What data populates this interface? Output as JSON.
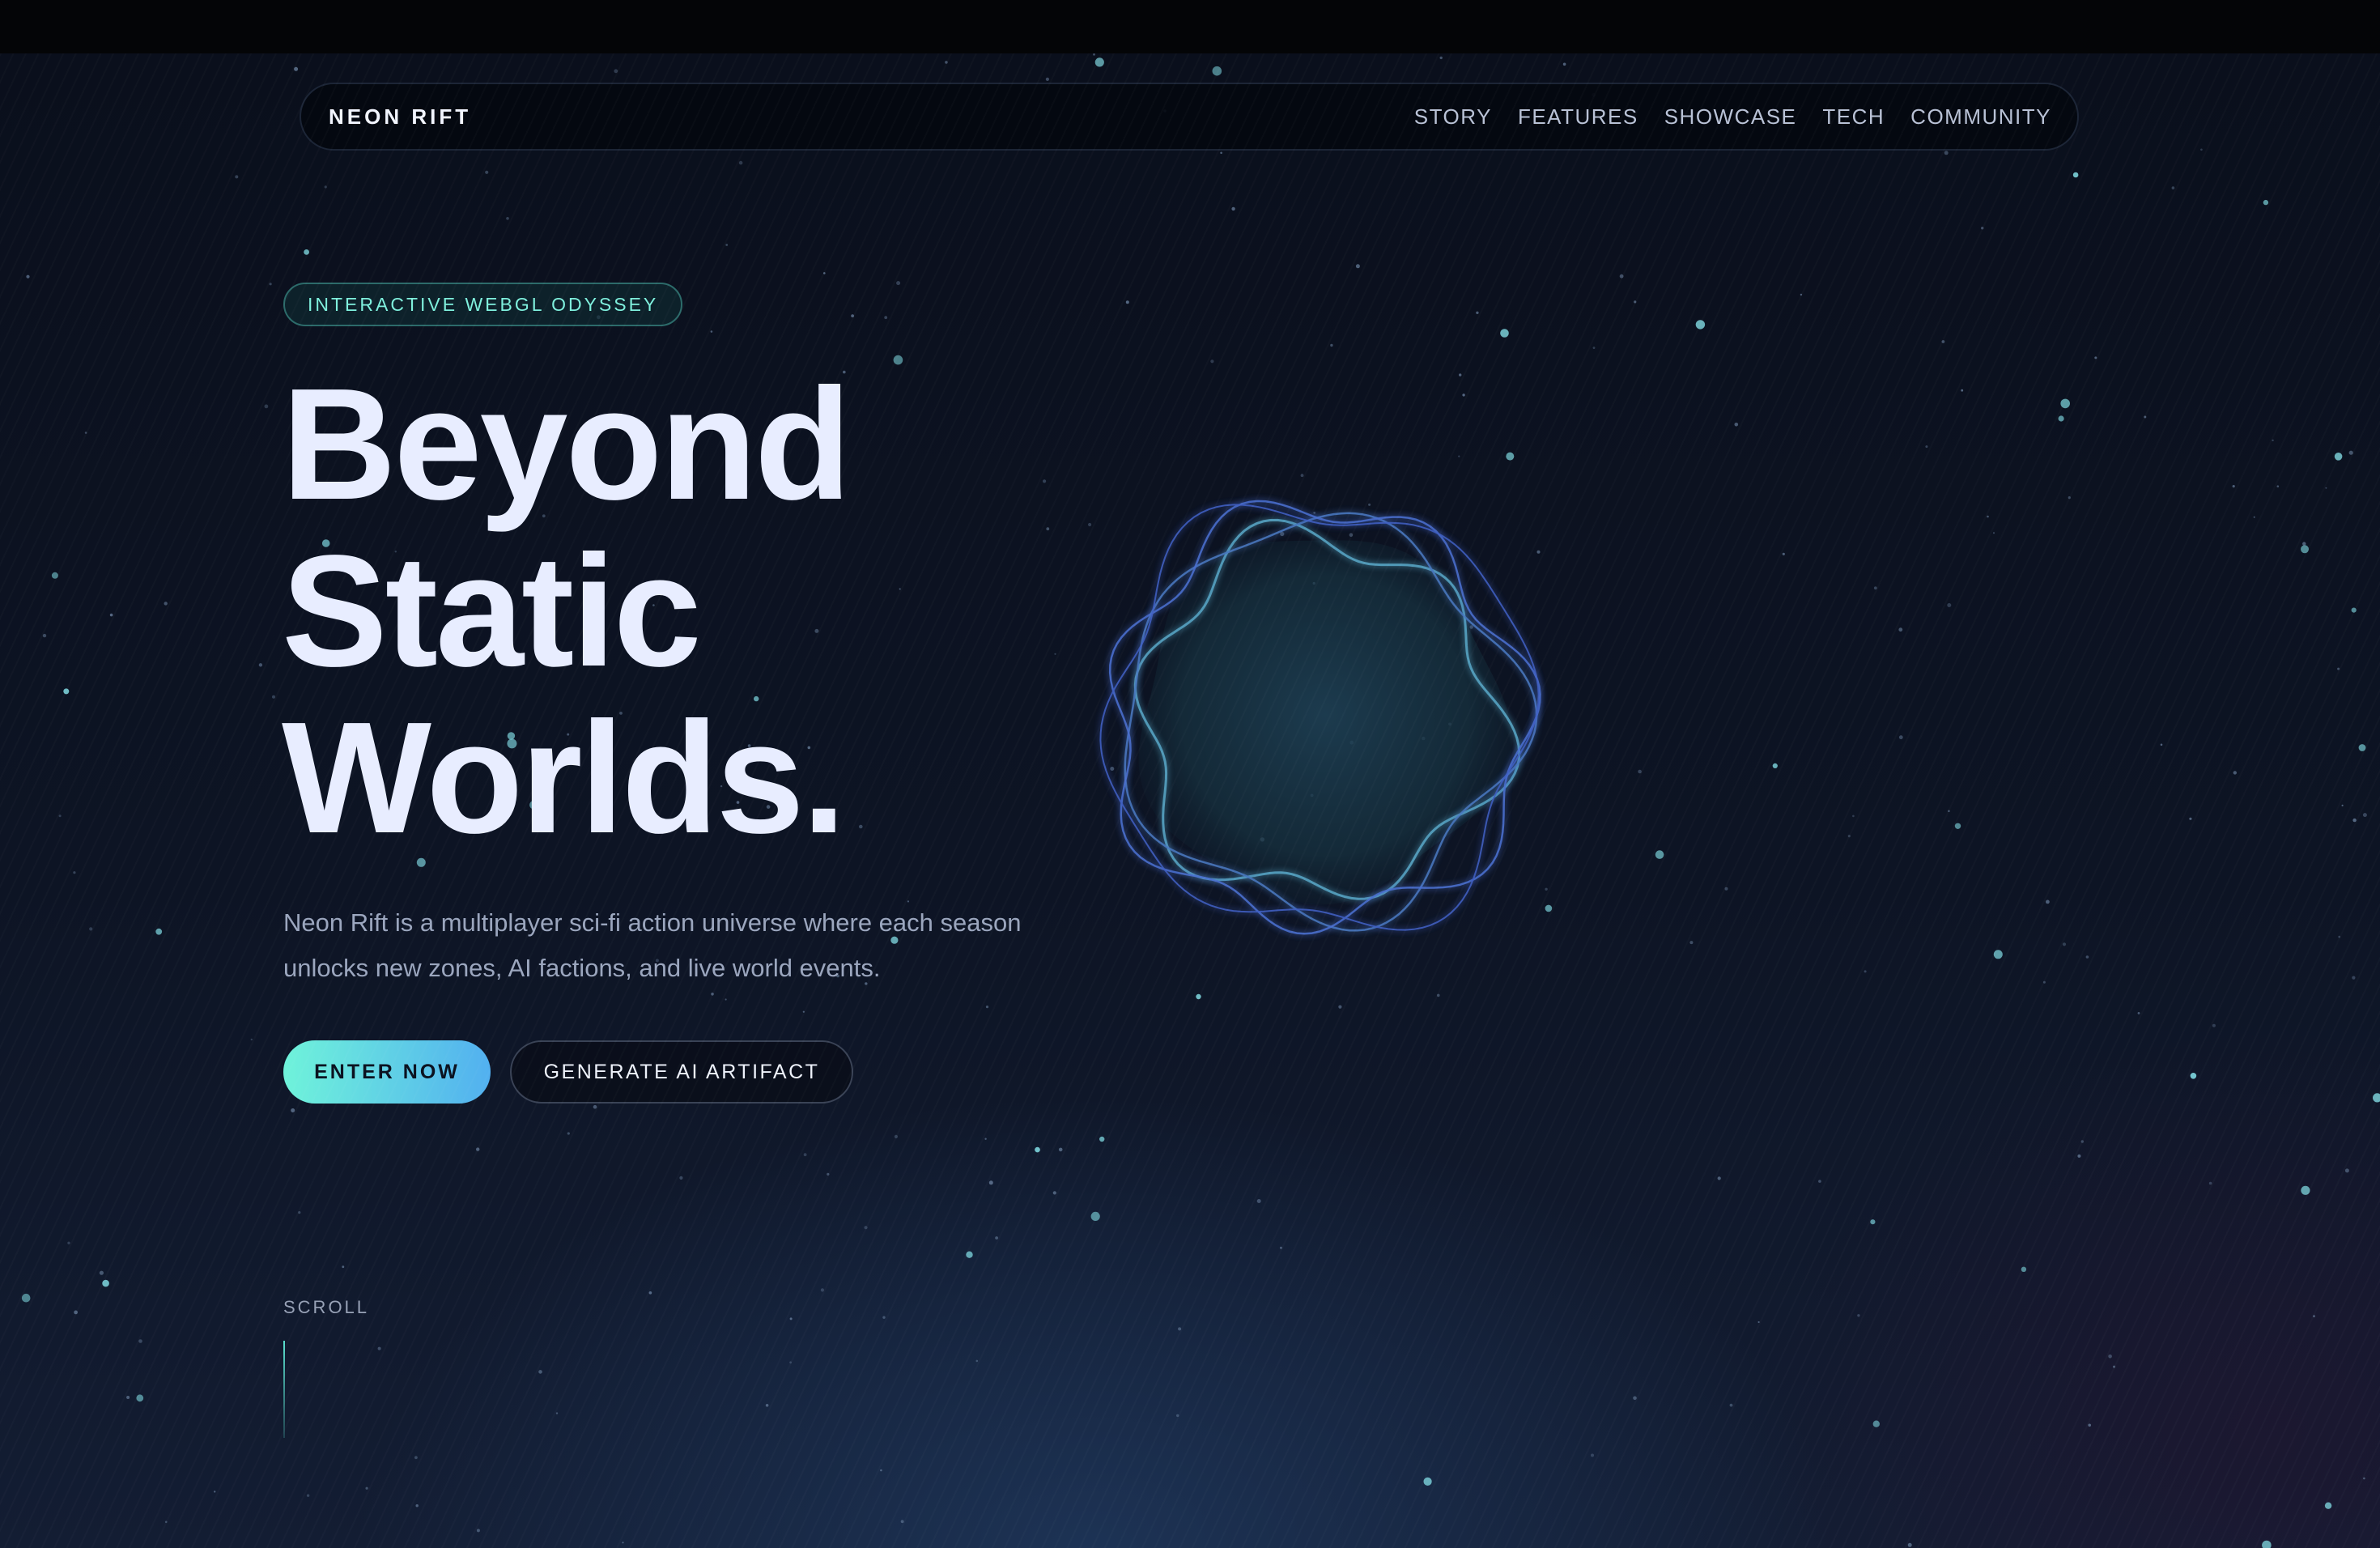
{
  "nav": {
    "brand": "NEON RIFT",
    "links": [
      "STORY",
      "FEATURES",
      "SHOWCASE",
      "TECH",
      "COMMUNITY"
    ]
  },
  "hero": {
    "badge": "INTERACTIVE WEBGL ODYSSEY",
    "title_lines": [
      "Beyond",
      "Static",
      "Worlds."
    ],
    "description": "Neon Rift is a multiplayer sci-fi action universe where each season unlocks new zones, AI factions, and live world events.",
    "primary_cta": "ENTER NOW",
    "secondary_cta": "GENERATE AI ARTIFACT"
  },
  "scroll_hint": "SCROLL",
  "colors": {
    "accent_teal": "#6ff3da",
    "accent_blue": "#52b0f0",
    "title": "#e8edff",
    "body_text": "#9ba6be",
    "background": "#0b1120"
  },
  "icons": {
    "hero_visual": "wavy-orb-icon"
  }
}
